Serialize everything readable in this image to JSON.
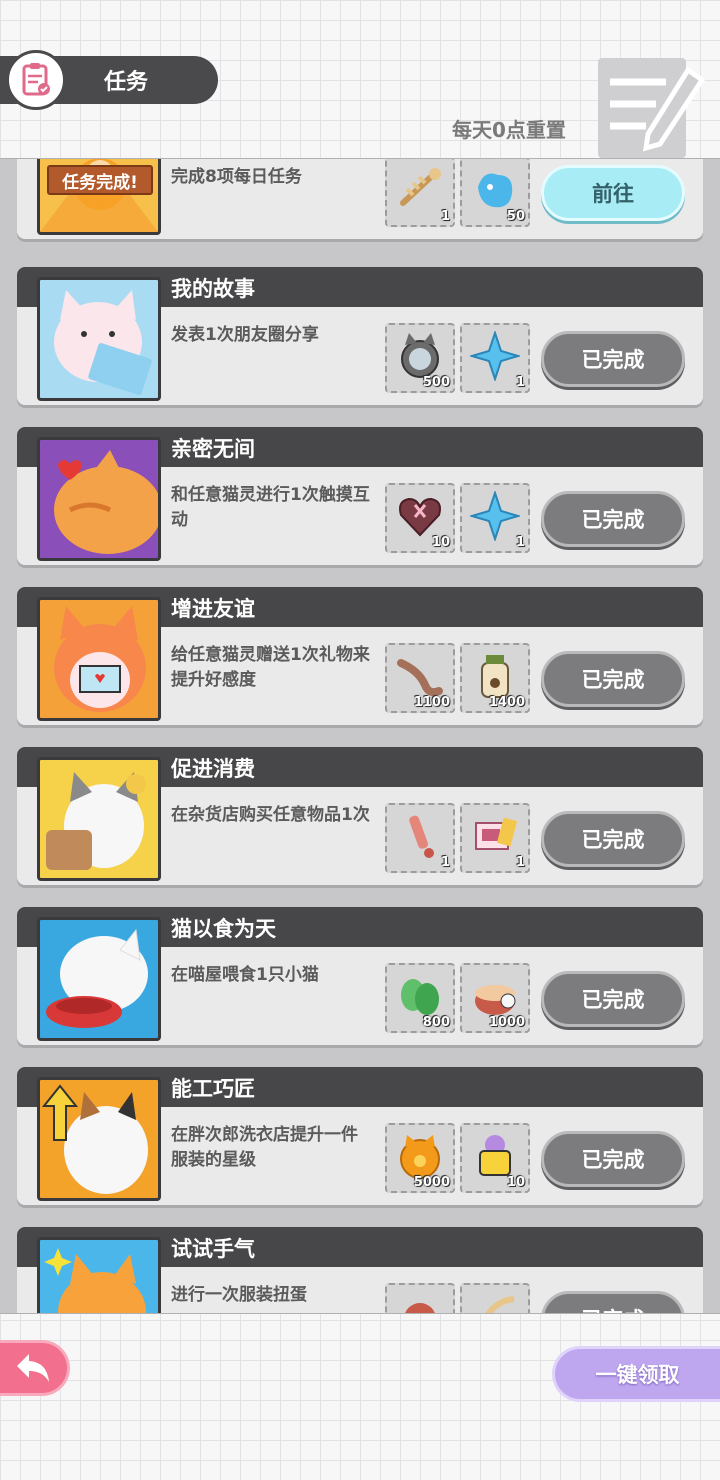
{
  "header": {
    "title": "任务",
    "reset_note": "每天0点重置"
  },
  "partial_top_card": {
    "badge": "任务完成!",
    "description": "完成8项每日任务",
    "rewards": [
      {
        "icon": "fishbone-icon",
        "count": "1"
      },
      {
        "icon": "blue-spirit-icon",
        "count": "50"
      }
    ],
    "button": "前往"
  },
  "tasks": [
    {
      "title": "我的故事",
      "description": "发表1次朋友圈分享",
      "rewards": [
        {
          "icon": "cat-coin-icon",
          "count": "500"
        },
        {
          "icon": "blue-star-icon",
          "count": "1"
        }
      ],
      "button": "已完成"
    },
    {
      "title": "亲密无间",
      "description": "和任意猫灵进行1次触摸互动",
      "rewards": [
        {
          "icon": "heart-box-icon",
          "count": "10"
        },
        {
          "icon": "blue-star-icon",
          "count": "1"
        }
      ],
      "button": "已完成"
    },
    {
      "title": "增进友谊",
      "description": "给任意猫灵赠送1次礼物来提升好感度",
      "rewards": [
        {
          "icon": "dried-fish-icon",
          "count": "1100"
        },
        {
          "icon": "paw-jar-icon",
          "count": "1400"
        }
      ],
      "button": "已完成"
    },
    {
      "title": "促进消费",
      "description": "在杂货店购买任意物品1次",
      "rewards": [
        {
          "icon": "red-key-icon",
          "count": "1"
        },
        {
          "icon": "gift-envelope-icon",
          "count": "1"
        }
      ],
      "button": "已完成"
    },
    {
      "title": "猫以食为天",
      "description": "在喵屋喂食1只小猫",
      "rewards": [
        {
          "icon": "catnip-leaf-icon",
          "count": "800"
        },
        {
          "icon": "fish-can-icon",
          "count": "1000"
        }
      ],
      "button": "已完成"
    },
    {
      "title": "能工巧匠",
      "description": "在胖次郎洗衣店提升一件服装的星级",
      "rewards": [
        {
          "icon": "gold-paw-coin-icon",
          "count": "5000"
        },
        {
          "icon": "cat-shirt-icon",
          "count": "10"
        }
      ],
      "button": "已完成"
    },
    {
      "title": "试试手气",
      "description": "进行一次服装扭蛋",
      "rewards": [
        {
          "icon": "cat-head-icon",
          "count": ""
        },
        {
          "icon": "feather-icon",
          "count": ""
        }
      ],
      "button": "已完成"
    }
  ],
  "footer": {
    "claim_all": "一键领取"
  },
  "colors": {
    "header_dark": "#47474a",
    "go_button": "#a8ecf6",
    "done_button": "#7c7c7e",
    "back_button": "#f26f8d",
    "claim_button": "#bfa7f0"
  }
}
